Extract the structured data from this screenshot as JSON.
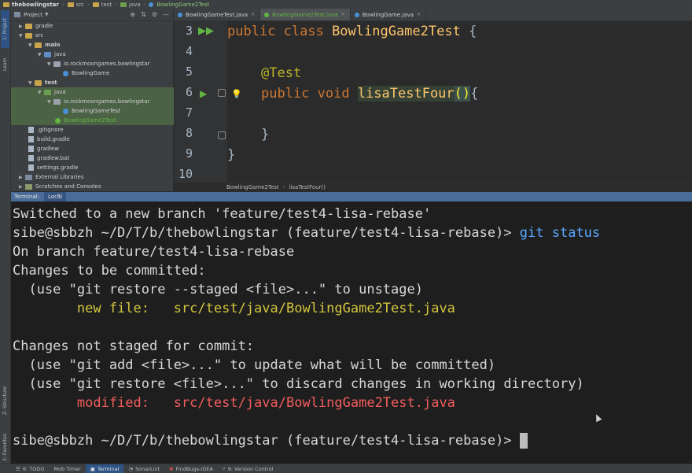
{
  "breadcrumb": {
    "project": "thebowlingstar",
    "items": [
      "src",
      "test",
      "java"
    ],
    "current": "BowlingGame2Test"
  },
  "left_stripe": {
    "project_tab": "1: Project",
    "learn_tab": "Learn",
    "structure_tab": "Z: Structure",
    "favorites_tab": "2: Favorites"
  },
  "project_panel": {
    "title": "Project",
    "tree": [
      {
        "label": "gradle",
        "icon": "folder-icon"
      },
      {
        "label": "src",
        "icon": "folder-icon"
      },
      {
        "label": "main",
        "icon": "folder-icon"
      },
      {
        "label": "java",
        "icon": "folder-icon"
      },
      {
        "label": "io.rockmoongames.bowlingstar",
        "icon": "package-icon"
      },
      {
        "label": "BowlingGame",
        "icon": "class-icon"
      },
      {
        "label": "test",
        "icon": "folder-icon"
      },
      {
        "label": "java",
        "icon": "folder-icon"
      },
      {
        "label": "io.rockmoongames.bowlingstar",
        "icon": "package-icon"
      },
      {
        "label": "BowlingGameTest",
        "icon": "class-icon"
      },
      {
        "label": "BowlingGame2Test",
        "icon": "class-icon"
      },
      {
        "label": ".gitignore",
        "icon": "file-icon"
      },
      {
        "label": "build.gradle",
        "icon": "file-icon"
      },
      {
        "label": "gradlew",
        "icon": "file-icon"
      },
      {
        "label": "gradlew.bat",
        "icon": "file-icon"
      },
      {
        "label": "settings.gradle",
        "icon": "file-icon"
      },
      {
        "label": "External Libraries",
        "icon": "library-icon"
      },
      {
        "label": "Scratches and Consoles",
        "icon": "scratch-icon"
      }
    ]
  },
  "editor": {
    "tabs": [
      {
        "label": "BowlingGameTest.java"
      },
      {
        "label": "BowlingGame2Test.java"
      },
      {
        "label": "BowlingGame.java"
      }
    ],
    "line_numbers": [
      "3",
      "4",
      "5",
      "6",
      "7",
      "8",
      "9",
      "10"
    ],
    "code": {
      "l3_kw": "public class ",
      "l3_cls": "BowlingGame2Test",
      "l3_rest": " {",
      "l5_ann": "@Test",
      "l6_kw": "public void ",
      "l6_name": "lisaTestFour",
      "l6_paren": "()",
      "l6_rest": "{",
      "l8": "}",
      "l9": "}"
    },
    "crumbs": [
      "BowlingGame2Test",
      "lisaTestFour()"
    ]
  },
  "terminal": {
    "header_label": "Terminal:",
    "tab": "Local",
    "lines": {
      "l1": "Switched to a new branch 'feature/test4-lisa-rebase'",
      "prompt": "sibe@sbbzh ~/D/T/b/thebowlingstar (feature/test4-lisa-rebase)> ",
      "command": "git status",
      "l3": "On branch feature/test4-lisa-rebase",
      "l4": "Changes to be committed:",
      "l5": "  (use \"git restore --staged <file>...\" to unstage)",
      "l6": "        new file:   src/test/java/BowlingGame2Test.java",
      "l8": "Changes not staged for commit:",
      "l9": "  (use \"git add <file>...\" to update what will be committed)",
      "l10": "  (use \"git restore <file>...\" to discard changes in working directory)",
      "l11": "        modified:   src/test/java/BowlingGame2Test.java"
    }
  },
  "bottom_bar": {
    "tabs": [
      "6: TODO",
      "Mob Timer",
      "Terminal",
      "SonarLint",
      "FindBugs-IDEA",
      "9: Version Control"
    ]
  }
}
